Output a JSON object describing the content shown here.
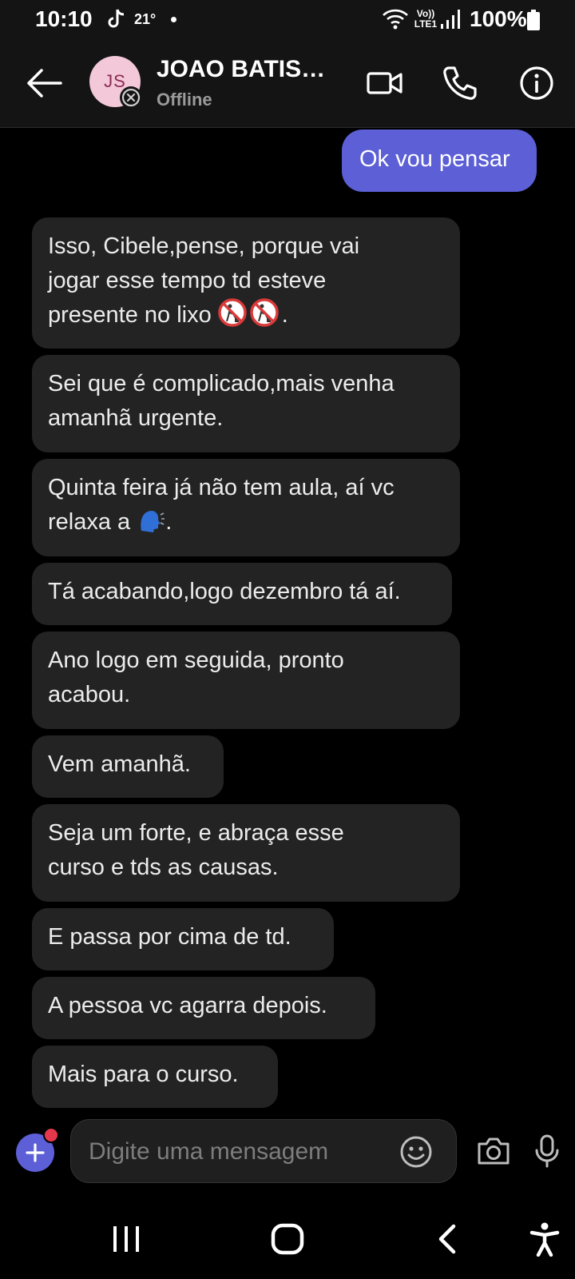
{
  "status_bar": {
    "time": "10:10",
    "temperature": "21°",
    "network_label": "Vo)) LTE1",
    "battery": "100%"
  },
  "header": {
    "avatar_initials": "JS",
    "contact_name": "JOAO BATIST…",
    "contact_status": "Offline",
    "icons": [
      "back-arrow-icon",
      "video-call-icon",
      "phone-icon",
      "info-icon"
    ]
  },
  "messages": [
    {
      "direction": "outgoing",
      "text": "Ok vou pensar"
    },
    {
      "direction": "incoming",
      "lines": [
        "Isso, Cibele,pense, porque vai",
        "jogar esse tempo td esteve",
        "presente no lixo"
      ],
      "trailing": "."
    },
    {
      "direction": "incoming",
      "lines": [
        "Sei que é complicado,mais venha",
        "amanhã urgente."
      ]
    },
    {
      "direction": "incoming",
      "lines": [
        "Quinta feira já não tem aula, aí vc",
        "relaxa a"
      ],
      "trailing": "."
    },
    {
      "direction": "incoming",
      "text": "Tá acabando,logo dezembro tá aí."
    },
    {
      "direction": "incoming",
      "lines": [
        "Ano logo em seguida, pronto",
        "acabou."
      ]
    },
    {
      "direction": "incoming",
      "text": "Vem amanhã."
    },
    {
      "direction": "incoming",
      "lines": [
        "Seja um forte, e abraça esse",
        "curso e tds as causas."
      ]
    },
    {
      "direction": "incoming",
      "text": "E passa por cima de td."
    },
    {
      "direction": "incoming",
      "text": "A pessoa vc agarra depois."
    },
    {
      "direction": "incoming",
      "text": "Mais para o curso."
    }
  ],
  "composer": {
    "placeholder": "Digite uma mensagem"
  },
  "colors": {
    "outgoing_bubble": "#5c5fd6",
    "incoming_bubble": "#232323",
    "background": "#000000",
    "notification_dot": "#e5384c"
  }
}
